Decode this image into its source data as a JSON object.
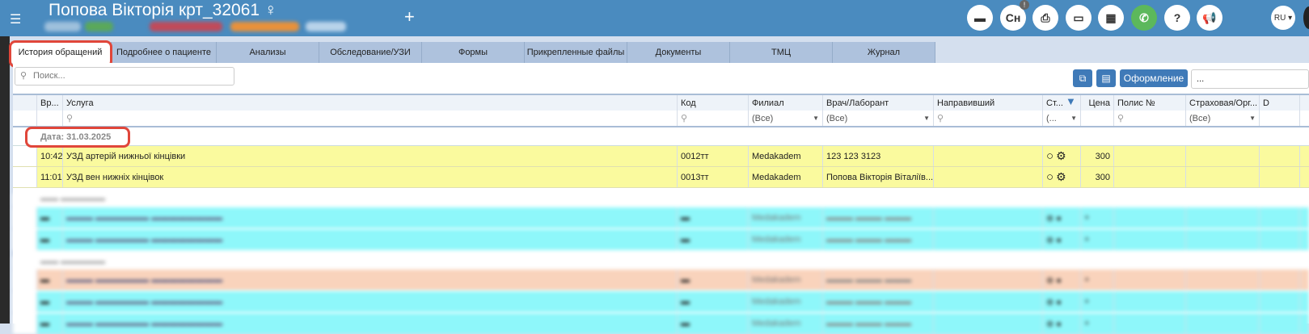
{
  "header": {
    "title": "Попова Вікторія крт_32061 ♀",
    "menu_icon": "hamburger-icon",
    "add_icon": "plus-icon",
    "icons": [
      {
        "name": "chat-icon",
        "glyph": "▬"
      },
      {
        "name": "signature-icon",
        "glyph": "Cн",
        "badge": "!"
      },
      {
        "name": "pdf-icon",
        "glyph": "⎙"
      },
      {
        "name": "card-icon",
        "glyph": "▭"
      },
      {
        "name": "calculator-icon",
        "glyph": "▦"
      },
      {
        "name": "phone-icon",
        "glyph": "✆"
      },
      {
        "name": "help-icon",
        "glyph": "?"
      },
      {
        "name": "megaphone-icon",
        "glyph": "📢"
      }
    ],
    "language": "RU ▾"
  },
  "tabs": [
    "История обращений",
    "Подробнее о пациенте",
    "Анализы",
    "Обследование/УЗИ",
    "Формы",
    "Прикрепленные файлы",
    "Документы",
    "ТМЦ",
    "Журнал"
  ],
  "toolbar": {
    "search_placeholder": "Поиск...",
    "design_button": "Оформление",
    "right_input": "..."
  },
  "table": {
    "columns": [
      "Вр...",
      "Услуга",
      "Код",
      "Филиал",
      "Врач/Лаборант",
      "Направивший",
      "Ст...",
      "Цена",
      "Полис №",
      "Страховая/Орг...",
      "D"
    ],
    "filters": {
      "filial": "(Все)",
      "doctor": "(Все)",
      "status": "(...",
      "insurance": "(Все)"
    },
    "group": "Дата: 31.03.2025",
    "rows": [
      {
        "time": "10:42",
        "service": "УЗД артерій нижньої кінцівки",
        "code": "0012тт",
        "filial": "Medakadem",
        "doctor": "123 123 3123",
        "price": "300"
      },
      {
        "time": "11:01",
        "service": "УЗД вен нижніх кінцівок",
        "code": "0013тт",
        "filial": "Medakadem",
        "doctor": "Попова Вікторія Віталіїв...",
        "price": "300"
      }
    ],
    "blurred_filial": "Medakadem"
  },
  "colors": {
    "header": "#4a8bbf",
    "row_yellow": "#fafa9e",
    "row_cyan": "#8ef7fa",
    "row_peach": "#f9d3bc",
    "button": "#3f7ab8",
    "highlight": "#e0463a"
  }
}
